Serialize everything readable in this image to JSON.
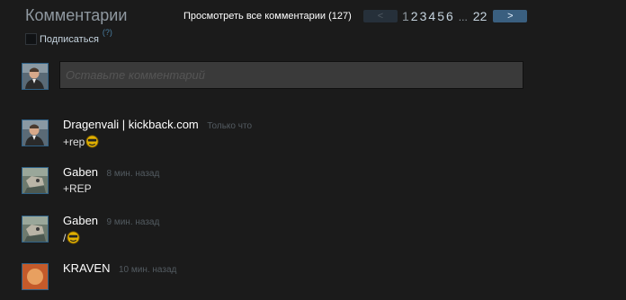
{
  "header": {
    "title": "Комментарии",
    "view_all": "Просмотреть все комментарии (127)",
    "pager": {
      "prev": "<",
      "next": ">",
      "pages": [
        "1",
        "2",
        "3",
        "4",
        "5",
        "6"
      ],
      "ellipsis": "...",
      "last": "22"
    }
  },
  "subscribe": {
    "label": "Подписаться",
    "help": "(?)"
  },
  "composer": {
    "placeholder": "Оставьте комментарий"
  },
  "comments": [
    {
      "author": "Dragenvali | kickback.com",
      "time": "Только что",
      "text": "+rep",
      "emote": true
    },
    {
      "author": "Gaben",
      "time": "8 мин. назад",
      "text": "+REP",
      "emote": false
    },
    {
      "author": "Gaben",
      "time": "9 мин. назад",
      "text": "/",
      "emote": true
    },
    {
      "author": "KRAVEN",
      "time": "10 мин. назад",
      "text": "",
      "emote": false
    }
  ],
  "colors": {
    "background": "#1b1b1b",
    "accent": "#3a5f7f",
    "avatar_border": "#2f6288"
  }
}
